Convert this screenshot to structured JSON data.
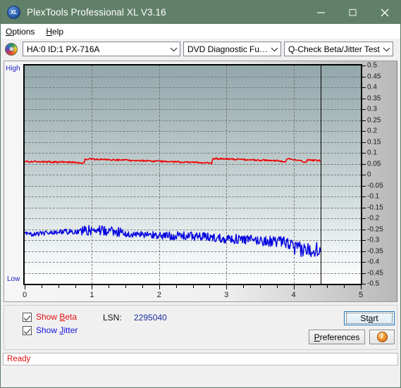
{
  "window": {
    "title": "PlexTools Professional XL V3.16",
    "app_icon": "xl-logo-icon",
    "minimize": "–",
    "maximize": "□",
    "close": "✕",
    "titlebar_color": "#61806a"
  },
  "menubar": {
    "items": [
      {
        "label": "Options",
        "accel": "O"
      },
      {
        "label": "Help",
        "accel": "H"
      }
    ]
  },
  "toolbar": {
    "drive_icon": "disc-icon",
    "drive_combo": {
      "value": "HA:0 ID:1  PX-716A"
    },
    "function_combo": {
      "value": "DVD Diagnostic Functions"
    },
    "test_combo": {
      "value": "Q-Check Beta/Jitter Test"
    },
    "arrow": "⌄"
  },
  "chart_data": {
    "type": "line",
    "title": "",
    "xlabel": "",
    "ylabel": "",
    "xlim": [
      0,
      5
    ],
    "ylim": [
      -0.5,
      0.5
    ],
    "xticks": [
      0,
      1,
      2,
      3,
      4,
      5
    ],
    "yticks": [
      0.5,
      0.45,
      0.4,
      0.35,
      0.3,
      0.25,
      0.2,
      0.15,
      0.1,
      0.05,
      0,
      -0.05,
      -0.1,
      -0.15,
      -0.2,
      -0.25,
      -0.3,
      -0.35,
      -0.4,
      -0.45,
      -0.5
    ],
    "grid": true,
    "axis_annotations": {
      "top": "High",
      "bottom": "Low"
    },
    "marker_line_x": 4.4,
    "plot_background": {
      "top": "#93a8ac",
      "bottom": "#fdfefe"
    },
    "series": [
      {
        "name": "Show Beta",
        "color": "#ee0000",
        "x": [
          0.0,
          0.1,
          0.2,
          0.3,
          0.4,
          0.5,
          0.6,
          0.7,
          0.8,
          0.88,
          0.9,
          1.0,
          1.1,
          1.2,
          1.3,
          1.4,
          1.5,
          1.6,
          1.7,
          1.8,
          1.9,
          2.0,
          2.1,
          2.2,
          2.3,
          2.4,
          2.5,
          2.6,
          2.7,
          2.78,
          2.8,
          2.9,
          3.0,
          3.1,
          3.2,
          3.3,
          3.4,
          3.5,
          3.6,
          3.7,
          3.8,
          3.88,
          3.9,
          4.0,
          4.1,
          4.18,
          4.2,
          4.3,
          4.4
        ],
        "y": [
          0.06,
          0.06,
          0.059,
          0.059,
          0.058,
          0.058,
          0.057,
          0.057,
          0.056,
          0.052,
          0.072,
          0.071,
          0.07,
          0.069,
          0.068,
          0.067,
          0.066,
          0.065,
          0.064,
          0.063,
          0.062,
          0.061,
          0.06,
          0.059,
          0.058,
          0.057,
          0.056,
          0.055,
          0.054,
          0.05,
          0.074,
          0.073,
          0.072,
          0.071,
          0.07,
          0.068,
          0.067,
          0.066,
          0.065,
          0.064,
          0.063,
          0.058,
          0.074,
          0.069,
          0.064,
          0.055,
          0.068,
          0.066,
          0.064
        ]
      },
      {
        "name": "Show Jitter",
        "color": "#0000e0",
        "x": [
          0.0,
          0.1,
          0.2,
          0.3,
          0.4,
          0.5,
          0.6,
          0.7,
          0.8,
          0.9,
          1.0,
          1.1,
          1.2,
          1.3,
          1.4,
          1.5,
          1.6,
          1.7,
          1.8,
          1.9,
          2.0,
          2.1,
          2.2,
          2.3,
          2.4,
          2.5,
          2.6,
          2.7,
          2.8,
          2.9,
          3.0,
          3.1,
          3.2,
          3.3,
          3.4,
          3.5,
          3.6,
          3.7,
          3.8,
          3.9,
          4.0,
          4.1,
          4.2,
          4.3,
          4.4
        ],
        "y": [
          -0.27,
          -0.272,
          -0.27,
          -0.268,
          -0.266,
          -0.264,
          -0.262,
          -0.26,
          -0.258,
          -0.256,
          -0.254,
          -0.256,
          -0.258,
          -0.262,
          -0.266,
          -0.27,
          -0.274,
          -0.276,
          -0.276,
          -0.278,
          -0.278,
          -0.279,
          -0.28,
          -0.28,
          -0.281,
          -0.282,
          -0.284,
          -0.286,
          -0.288,
          -0.29,
          -0.292,
          -0.294,
          -0.296,
          -0.298,
          -0.3,
          -0.302,
          -0.304,
          -0.306,
          -0.308,
          -0.31,
          -0.34,
          -0.344,
          -0.346,
          -0.34,
          -0.336
        ],
        "noise_amplitude": 0.018
      }
    ]
  },
  "controls": {
    "show_beta": {
      "label_pre": "Show ",
      "label_accel": "B",
      "label_post": "eta",
      "checked": true,
      "color": "#e01010"
    },
    "show_jitter": {
      "label_pre": "Show ",
      "label_accel": "J",
      "label_post": "itter",
      "checked": true,
      "color": "#1414dd"
    },
    "lsn_label": "LSN:",
    "lsn_value": "2295040",
    "start_button": {
      "pre": "St",
      "accel": "a",
      "post": "rt"
    },
    "preferences_button": {
      "pre": "",
      "accel": "P",
      "post": "references"
    },
    "info_button": {
      "icon": "info-icon",
      "glyph": "i"
    }
  },
  "statusbar": {
    "text": "Ready"
  }
}
